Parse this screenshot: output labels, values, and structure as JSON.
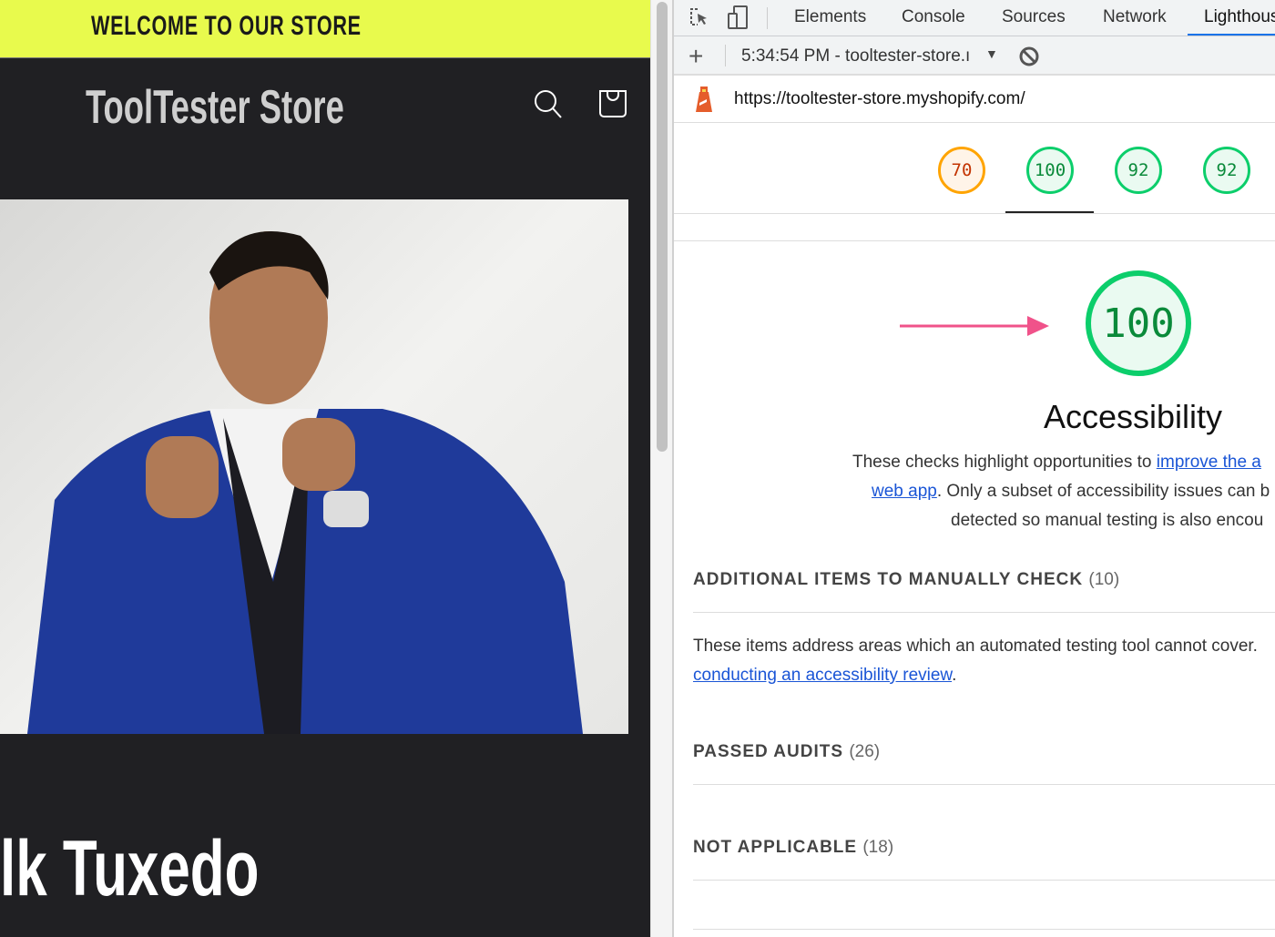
{
  "store": {
    "banner": "WELCOME TO OUR STORE",
    "name": "ToolTester Store",
    "product_title": "lk Tuxedo",
    "colors": {
      "banner": "#e8fa4d",
      "header": "#202023"
    }
  },
  "devtools": {
    "tabs": [
      {
        "label": "Elements"
      },
      {
        "label": "Console"
      },
      {
        "label": "Sources"
      },
      {
        "label": "Network"
      },
      {
        "label": "Lighthous",
        "active": true
      }
    ],
    "report_select": "5:34:54 PM - tooltester-store.ı",
    "url": "https://tooltester-store.myshopify.com/",
    "scores": [
      {
        "value": "70",
        "color": "#ffa400"
      },
      {
        "value": "100",
        "color": "#0cce6b"
      },
      {
        "value": "92",
        "color": "#0cce6b"
      },
      {
        "value": "92",
        "color": "#0cce6b"
      }
    ],
    "category": {
      "score": "100",
      "title": "Accessibility",
      "desc1": "These checks highlight opportunities to ",
      "link1": "improve the a",
      "link2": "web app",
      "desc2": ". Only a subset of accessibility issues can b",
      "desc3": "detected so manual testing is also encou"
    },
    "sections": [
      {
        "title": "ADDITIONAL ITEMS TO MANUALLY CHECK",
        "count": "(10)"
      },
      {
        "title": "PASSED AUDITS",
        "count": "(26)"
      },
      {
        "title": "NOT APPLICABLE",
        "count": "(18)"
      }
    ],
    "manual_desc": "These items address areas which an automated testing tool cannot cover.",
    "manual_link": "conducting an accessibility review",
    "manual_period": "."
  }
}
